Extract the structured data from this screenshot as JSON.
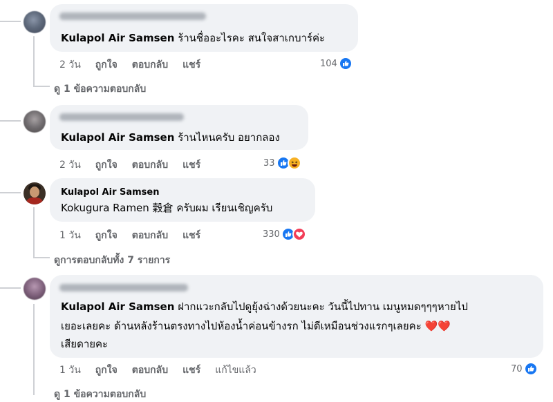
{
  "comments": [
    {
      "author_hidden": true,
      "mention": "Kulapol Air Samsen",
      "text": " ร้านชื่ออะไรคะ สนใจสาเกบาร์ค่ะ",
      "time": "2 วัน",
      "like_label": "ถูกใจ",
      "reply_label": "ตอบกลับ",
      "share_label": "แชร์",
      "reactions": {
        "count": "104",
        "types": [
          "like"
        ]
      },
      "view_replies": "ดู 1 ข้อความตอบกลับ"
    },
    {
      "author_hidden": true,
      "mention": "Kulapol Air Samsen",
      "text": " ร้านไหนครับ อยากลอง",
      "time": "2 วัน",
      "like_label": "ถูกใจ",
      "reply_label": "ตอบกลับ",
      "share_label": "แชร์",
      "reactions": {
        "count": "33",
        "types": [
          "like",
          "haha"
        ]
      }
    },
    {
      "author": "Kulapol Air Samsen",
      "text": "Kokugura Ramen 穀倉 ครับผม เรียนเชิญครับ",
      "time": "1 วัน",
      "like_label": "ถูกใจ",
      "reply_label": "ตอบกลับ",
      "share_label": "แชร์",
      "reactions": {
        "count": "330",
        "types": [
          "like",
          "love"
        ]
      },
      "view_replies": "ดูการตอบกลับทั้ง 7 รายการ"
    },
    {
      "author_hidden": true,
      "mention": "Kulapol Air Samsen",
      "line1": " ฝากแวะกลับไปดูยุ้งฉ่างด้วยนะคะ วันนี้ไปทาน เมนูหมดๆๆๆหายไป",
      "line2": "เยอะเลยคะ ด้านหลังร้านตรงทางไปห้องน้ำค่อนข้างรก ไม่ดีเหมือนช่วงแรกๆเลยคะ ❤️❤️",
      "line3": "เสียดายคะ",
      "time": "1 วัน",
      "like_label": "ถูกใจ",
      "reply_label": "ตอบกลับ",
      "share_label": "แชร์",
      "edited_label": "แก้ไขแล้ว",
      "reactions": {
        "count": "70",
        "types": [
          "like"
        ]
      },
      "view_replies": "ดู 1 ข้อความตอบกลับ"
    }
  ],
  "colors": {
    "bubble": "#f0f2f5",
    "muted": "#65676b",
    "like": "#1877f2",
    "love": "#f33e58",
    "haha": "#f7b125"
  },
  "icons": [
    "like-icon",
    "haha-icon",
    "love-icon"
  ]
}
